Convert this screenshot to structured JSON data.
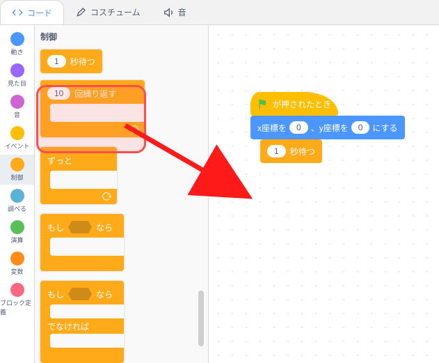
{
  "tabs": {
    "code": "コード",
    "costumes": "コスチューム",
    "sounds": "音"
  },
  "categories": [
    {
      "key": "motion",
      "label": "動き",
      "color": "#4c97ff"
    },
    {
      "key": "looks",
      "label": "見た目",
      "color": "#9966ff"
    },
    {
      "key": "sound",
      "label": "音",
      "color": "#cf63cf"
    },
    {
      "key": "events",
      "label": "イベント",
      "color": "#ffbf00"
    },
    {
      "key": "control",
      "label": "制御",
      "color": "#ffab19"
    },
    {
      "key": "sensing",
      "label": "調べる",
      "color": "#5cb1d6"
    },
    {
      "key": "operators",
      "label": "演算",
      "color": "#59c059"
    },
    {
      "key": "variables",
      "label": "変数",
      "color": "#ff8c1a"
    },
    {
      "key": "myblocks",
      "label": "ブロック定義",
      "color": "#ff6680"
    }
  ],
  "palette": {
    "title": "制御",
    "wait": {
      "value": "1",
      "suffix": "秒待つ"
    },
    "repeat": {
      "value": "10",
      "suffix": "回繰り返す"
    },
    "forever": {
      "label": "ずっと"
    },
    "if": {
      "prefix": "もし",
      "suffix": "なら"
    },
    "ifelse": {
      "prefix": "もし",
      "mid": "なら",
      "else": "でなければ"
    }
  },
  "workspace": {
    "hat": "が押されたとき",
    "goto": {
      "p1": "x座標を",
      "v1": "0",
      "p2": "、y座標を",
      "v2": "0",
      "p3": "にする"
    },
    "wait": {
      "value": "1",
      "suffix": "秒待つ"
    }
  }
}
